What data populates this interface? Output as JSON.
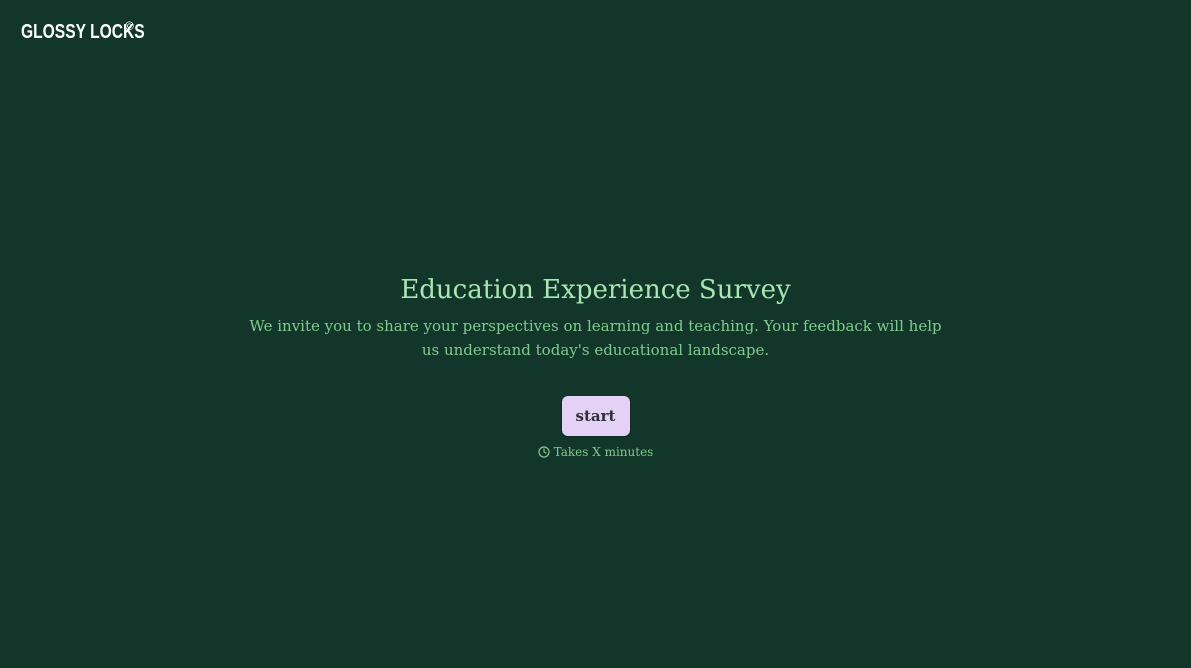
{
  "brand": {
    "name": "GLOSSY LOCKS",
    "mark": "©"
  },
  "hero": {
    "title": "Education Experience Survey",
    "subtitle": "We invite you to share your perspectives on learning and teaching. Your feedback will help us understand today's educational landscape."
  },
  "cta": {
    "start_label": "start"
  },
  "meta": {
    "icon": "clock-icon",
    "duration_text": "Takes X minutes"
  },
  "colors": {
    "background": "#12372a",
    "title": "#a8e6b2",
    "body_text": "#82c98d",
    "button_bg": "#e3d2f5",
    "button_text": "#2f2f3a",
    "logo": "#ffffff"
  }
}
